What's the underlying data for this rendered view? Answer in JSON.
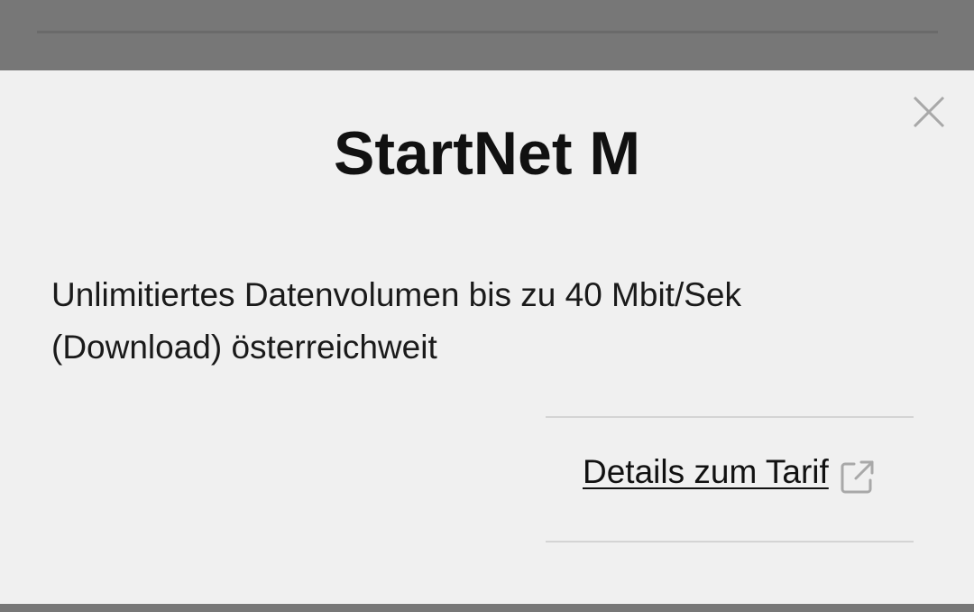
{
  "modal": {
    "title": "StartNet M",
    "description_line1": "Unlimitiertes Datenvolumen bis zu 40 Mbit/Sek",
    "description_line2": "(Download) österreichweit",
    "details_link_label": "Details zum Tarif",
    "close_icon": "close-icon",
    "external_link_icon": "external-link-icon"
  },
  "colors": {
    "backdrop": "#777777",
    "modal_background": "#f0f0f0",
    "text": "#111111",
    "icon": "#a8a8a8",
    "divider": "#d4d4d4"
  }
}
